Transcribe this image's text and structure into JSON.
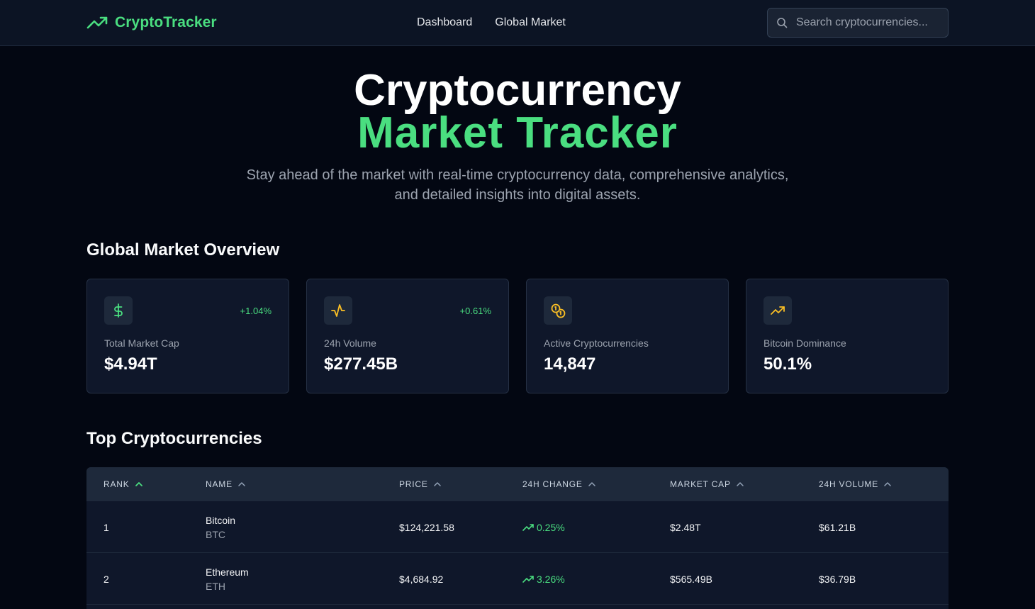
{
  "header": {
    "brand": "CryptoTracker",
    "nav": [
      "Dashboard",
      "Global Market"
    ],
    "search_placeholder": "Search cryptocurrencies..."
  },
  "hero": {
    "line1": "Cryptocurrency",
    "line2": "Market Tracker",
    "subtitle_line1": "Stay ahead of the market with real-time cryptocurrency data, comprehensive analytics,",
    "subtitle_line2": "and detailed insights into digital assets."
  },
  "overview": {
    "title": "Global Market Overview",
    "cards": [
      {
        "icon": "dollar-icon",
        "label": "Total Market Cap",
        "value": "$4.94T",
        "change": "+1.04%"
      },
      {
        "icon": "activity-icon",
        "label": "24h Volume",
        "value": "$277.45B",
        "change": "+0.61%"
      },
      {
        "icon": "coins-icon",
        "label": "Active Cryptocurrencies",
        "value": "14,847",
        "change": ""
      },
      {
        "icon": "trending-up-icon",
        "label": "Bitcoin Dominance",
        "value": "50.1%",
        "change": ""
      }
    ]
  },
  "table": {
    "title": "Top Cryptocurrencies",
    "columns": [
      "RANK",
      "NAME",
      "PRICE",
      "24H CHANGE",
      "MARKET CAP",
      "24H VOLUME"
    ],
    "rows": [
      {
        "rank": "1",
        "name": "Bitcoin",
        "symbol": "BTC",
        "price": "$124,221.58",
        "change": "0.25%",
        "market_cap": "$2.48T",
        "volume": "$61.21B"
      },
      {
        "rank": "2",
        "name": "Ethereum",
        "symbol": "ETH",
        "price": "$4,684.92",
        "change": "3.26%",
        "market_cap": "$565.49B",
        "volume": "$36.79B"
      }
    ]
  },
  "colors": {
    "accent": "#4ade80",
    "warning_icon": "#fbbf24",
    "background": "#030712",
    "card": "#0f172a"
  }
}
